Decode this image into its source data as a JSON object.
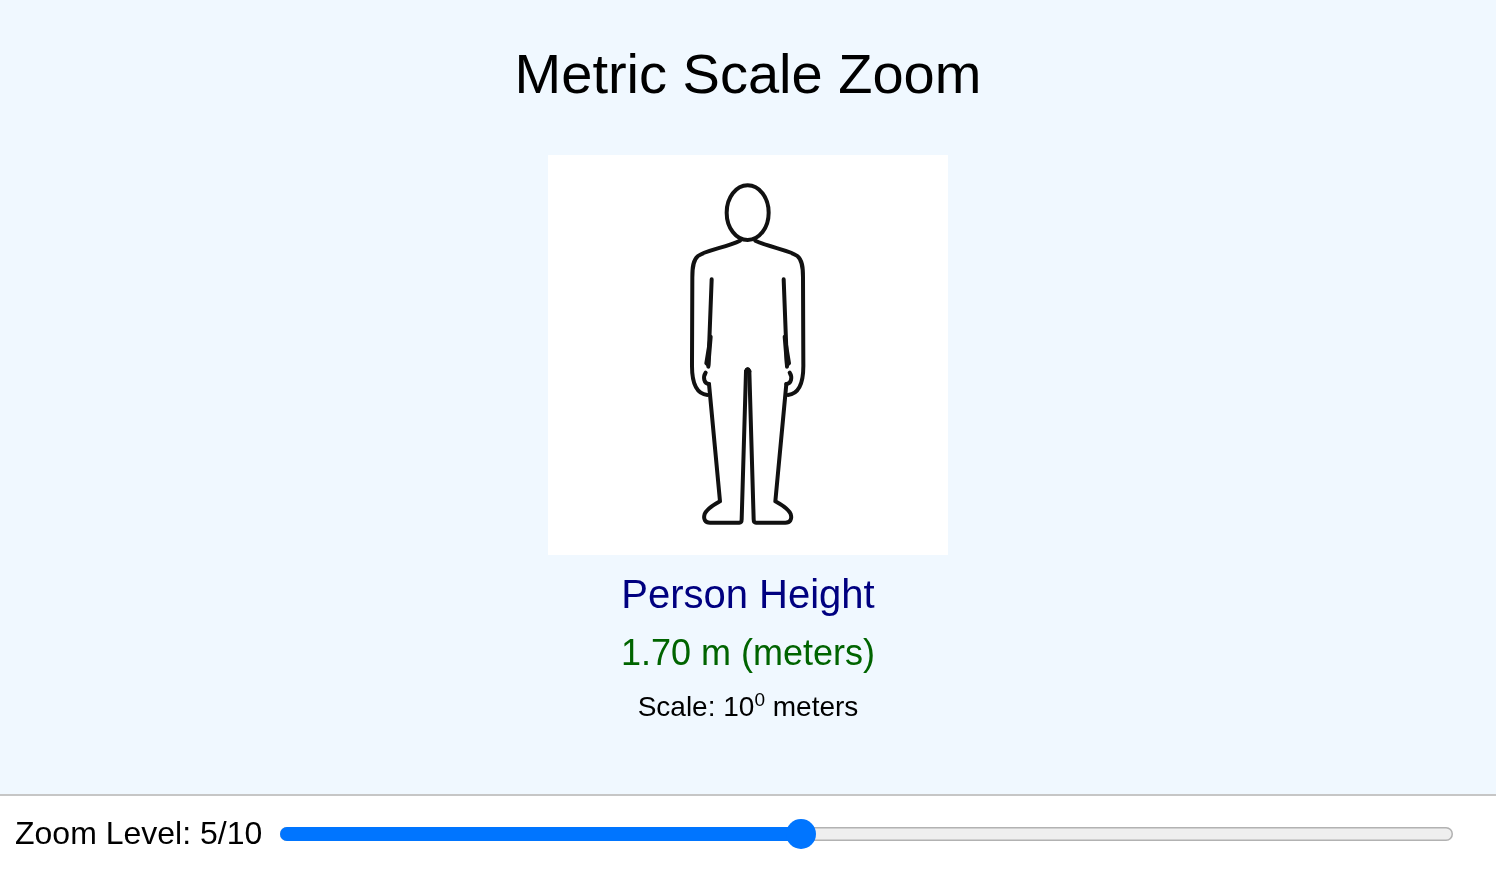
{
  "title": "Metric Scale Zoom",
  "object": {
    "name": "Person Height",
    "size": "1.70 m (meters)",
    "scale": "Scale: 10$^{0}$ meters"
  },
  "zoom": {
    "label": "Zoom Level: 5/10",
    "level": 0.444
  }
}
